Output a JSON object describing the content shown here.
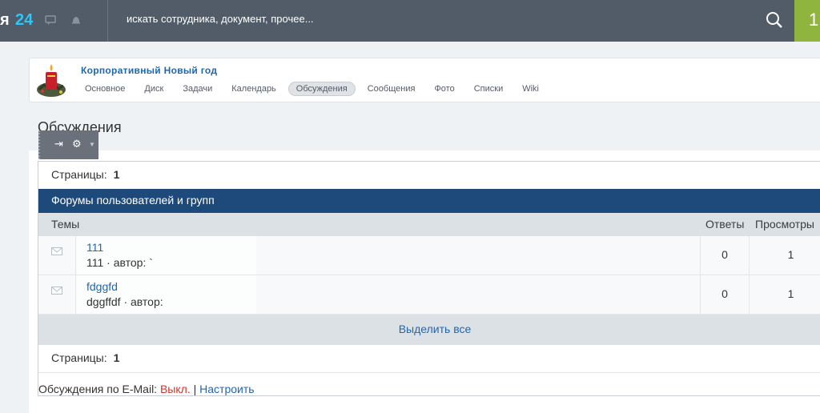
{
  "topbar": {
    "brand_prefix": "я",
    "brand_suffix": "24",
    "search_placeholder": "искать сотрудника, документ, прочее...",
    "counter": "1"
  },
  "group": {
    "title": "Корпоративный Новый год",
    "nav": [
      {
        "label": "Основное",
        "active": false
      },
      {
        "label": "Диск",
        "active": false
      },
      {
        "label": "Задачи",
        "active": false
      },
      {
        "label": "Календарь",
        "active": false
      },
      {
        "label": "Обсуждения",
        "active": true
      },
      {
        "label": "Сообщения",
        "active": false
      },
      {
        "label": "Фото",
        "active": false
      },
      {
        "label": "Списки",
        "active": false
      },
      {
        "label": "Wiki",
        "active": false
      }
    ]
  },
  "page": {
    "title": "Обсуждения"
  },
  "forum": {
    "pages_label": "Страницы:",
    "pages_value": "1",
    "name": "Форумы пользователей и групп",
    "columns": {
      "topics": "Темы",
      "answers": "Ответы",
      "views": "Просмотры"
    },
    "topics": [
      {
        "title": "111",
        "subtitle": "111 · автор: `",
        "answers": "0",
        "views": "1"
      },
      {
        "title": "fdggfd",
        "subtitle": "dggffdf · автор:",
        "answers": "0",
        "views": "1"
      }
    ],
    "select_all": "Выделить все",
    "email_label": "Обсуждения по E-Mail:",
    "email_state": "Выкл.",
    "email_sep": "|",
    "email_configure": "Настроить"
  }
}
